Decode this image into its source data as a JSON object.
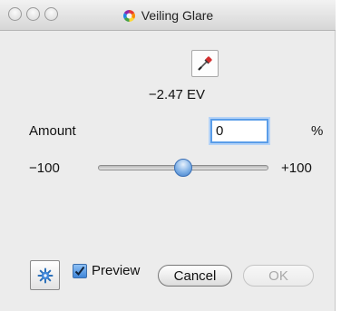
{
  "window": {
    "title": "Veiling Glare"
  },
  "measure": {
    "ev_value": "−2.47 EV"
  },
  "amount": {
    "label": "Amount",
    "value": "0",
    "unit": "%"
  },
  "slider": {
    "min_label": "−100",
    "max_label": "+100",
    "min": -100,
    "max": 100,
    "value": 0
  },
  "footer": {
    "preview_label": "Preview",
    "preview_checked": true,
    "cancel_label": "Cancel",
    "ok_label": "OK"
  },
  "icons": {
    "title": "color-wheel-icon",
    "eyedropper": "eyedropper-icon",
    "settings": "gear-icon",
    "check": "checkmark-icon"
  },
  "colors": {
    "focus": "#5a9de8",
    "accent": "#3f86d9",
    "disabled_text": "#a9a9a9"
  }
}
